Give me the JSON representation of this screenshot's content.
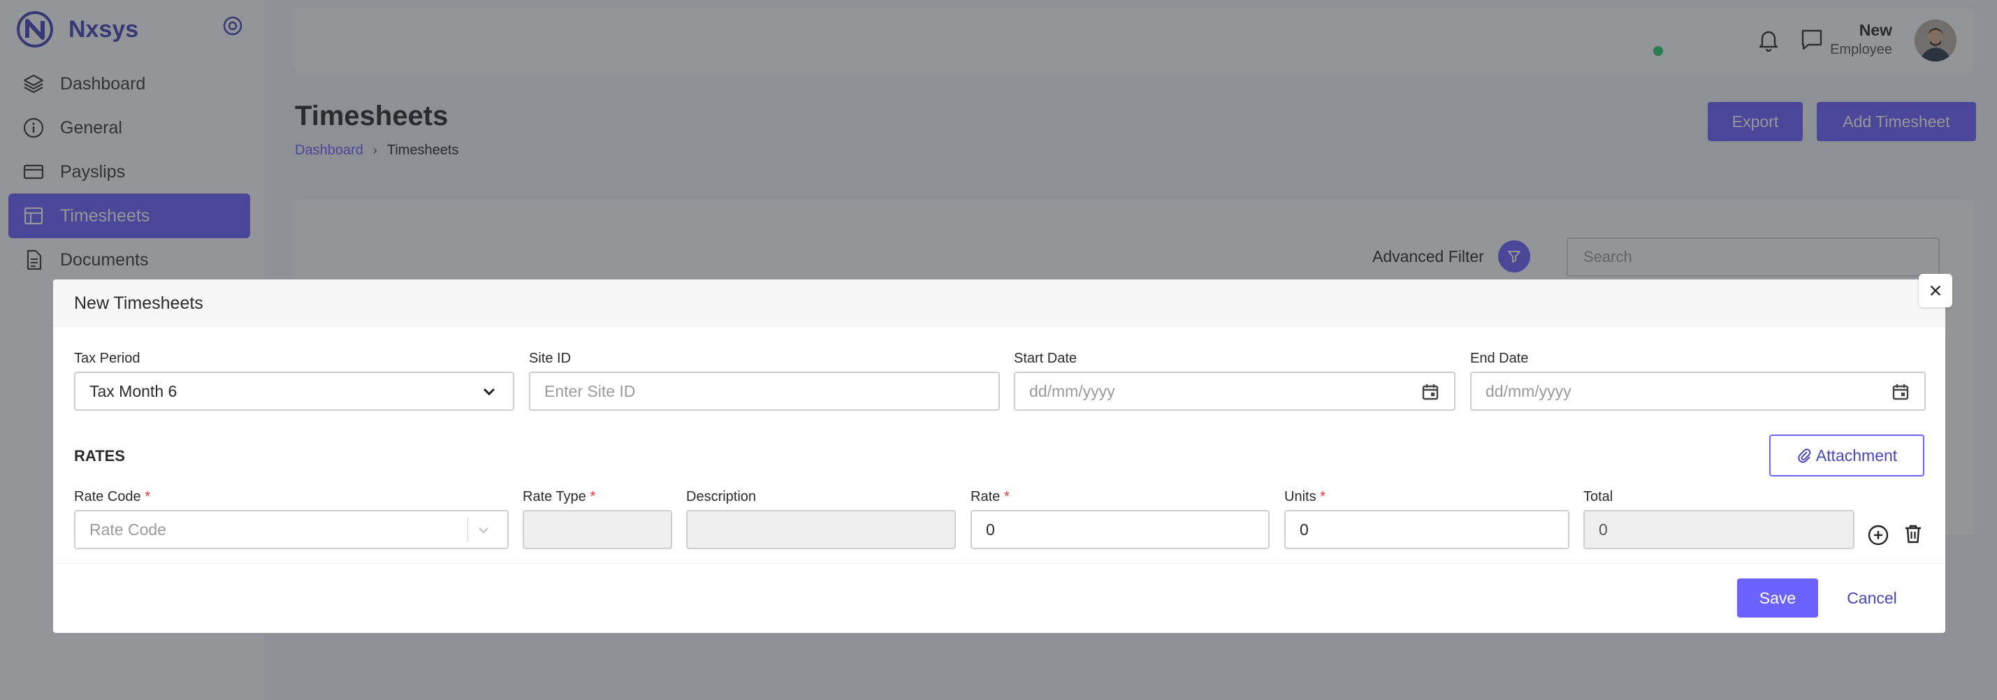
{
  "app": {
    "name": "Nxsys"
  },
  "colors": {
    "accent": "#6c63ff",
    "accent_dark": "#4b45b8",
    "required": "#e53935",
    "online": "#2ecc71"
  },
  "sidebar": {
    "items": [
      {
        "label": "Dashboard",
        "icon": "layers-icon",
        "active": false
      },
      {
        "label": "General",
        "icon": "info-icon",
        "active": false
      },
      {
        "label": "Payslips",
        "icon": "card-icon",
        "active": false
      },
      {
        "label": "Timesheets",
        "icon": "table-icon",
        "active": true
      },
      {
        "label": "Documents",
        "icon": "document-icon",
        "active": false
      }
    ]
  },
  "header": {
    "user_name": "New",
    "user_role": "Employee"
  },
  "page": {
    "title": "Timesheets",
    "breadcrumb": {
      "parent": "Dashboard",
      "current": "Timesheets"
    },
    "export_label": "Export",
    "add_label": "Add Timesheet",
    "advanced_filter_label": "Advanced Filter",
    "search_placeholder": "Search"
  },
  "modal": {
    "title": "New Timesheets",
    "tax_period": {
      "label": "Tax Period",
      "value": "Tax Month 6"
    },
    "site_id": {
      "label": "Site ID",
      "placeholder": "Enter Site ID"
    },
    "start_date": {
      "label": "Start Date",
      "placeholder": "dd/mm/yyyy"
    },
    "end_date": {
      "label": "End Date",
      "placeholder": "dd/mm/yyyy"
    },
    "rates_title": "RATES",
    "attachment_label": "Attachment",
    "rate_code": {
      "label": "Rate Code",
      "placeholder": "Rate Code"
    },
    "rate_type": {
      "label": "Rate Type",
      "value": ""
    },
    "description": {
      "label": "Description",
      "value": ""
    },
    "rate": {
      "label": "Rate",
      "value": "0"
    },
    "units": {
      "label": "Units",
      "value": "0"
    },
    "total": {
      "label": "Total",
      "value": "0"
    },
    "required_mark": "*",
    "save_label": "Save",
    "cancel_label": "Cancel"
  }
}
